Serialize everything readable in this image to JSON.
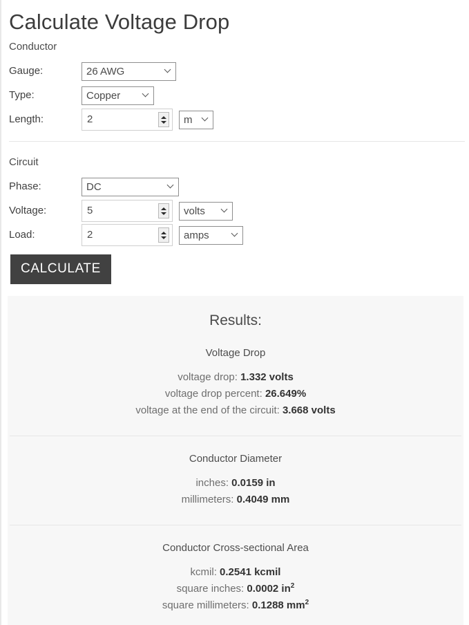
{
  "page": {
    "title": "Calculate Voltage Drop"
  },
  "conductor": {
    "section_label": "Conductor",
    "gauge": {
      "label": "Gauge:",
      "value": "26 AWG"
    },
    "type": {
      "label": "Type:",
      "value": "Copper"
    },
    "length": {
      "label": "Length:",
      "value": "2",
      "unit": "m"
    }
  },
  "circuit": {
    "section_label": "Circuit",
    "phase": {
      "label": "Phase:",
      "value": "DC"
    },
    "voltage": {
      "label": "Voltage:",
      "value": "5",
      "unit": "volts"
    },
    "load": {
      "label": "Load:",
      "value": "2",
      "unit": "amps"
    }
  },
  "actions": {
    "calculate_label": "CALCULATE"
  },
  "results": {
    "title": "Results:",
    "groups": [
      {
        "heading": "Voltage Drop",
        "lines": [
          {
            "label": "voltage drop:",
            "value": "1.332 volts"
          },
          {
            "label": "voltage drop percent:",
            "value": "26.649%"
          },
          {
            "label": "voltage at the end of the circuit:",
            "value": "3.668 volts"
          }
        ]
      },
      {
        "heading": "Conductor Diameter",
        "lines": [
          {
            "label": "inches:",
            "value": "0.0159 in"
          },
          {
            "label": "millimeters:",
            "value": "0.4049 mm"
          }
        ]
      },
      {
        "heading": "Conductor Cross-sectional Area",
        "lines": [
          {
            "label": "kcmil:",
            "value": "0.2541 kcmil"
          },
          {
            "label": "square inches:",
            "value": "0.0002 in",
            "sup": "2"
          },
          {
            "label": "square millimeters:",
            "value": "0.1288 mm",
            "sup": "2"
          }
        ]
      }
    ]
  },
  "icons": {
    "chevron_down": "chevron-down-icon",
    "spinner_up": "spinner-up-icon",
    "spinner_down": "spinner-down-icon"
  },
  "colors": {
    "button_bg": "#414141",
    "results_bg": "#f7f7f7",
    "divider": "#e6e6e6",
    "text": "#3a3a3a"
  }
}
